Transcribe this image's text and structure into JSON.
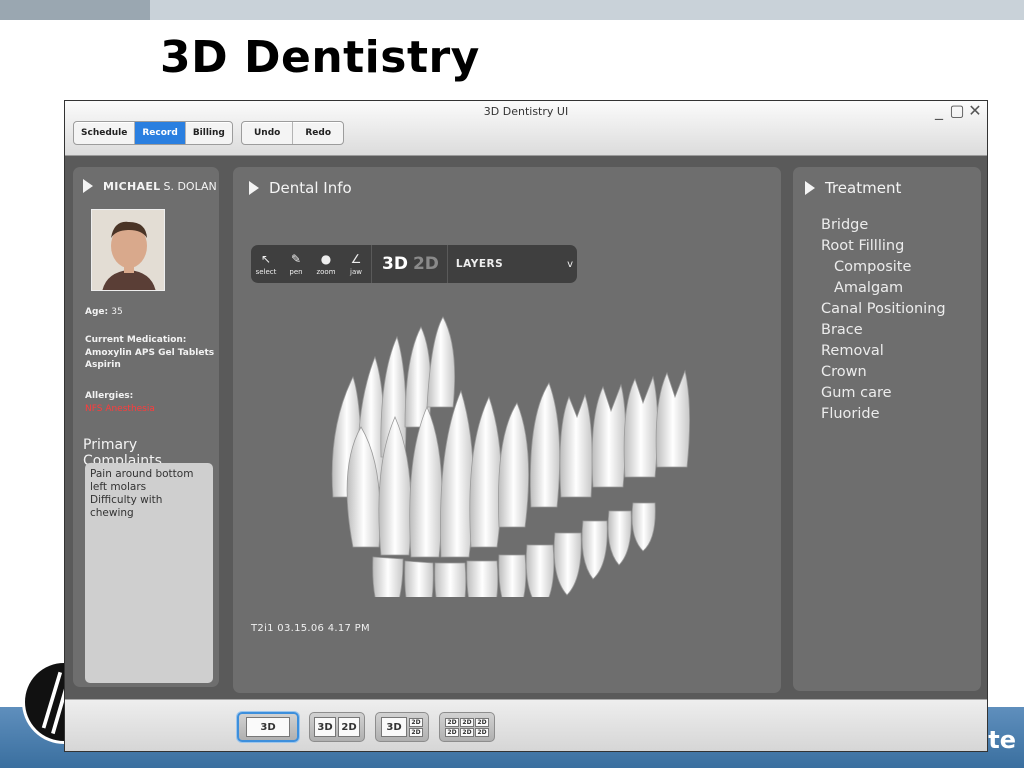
{
  "slide": {
    "title": "3D Dentistry",
    "footer_text": "te"
  },
  "window": {
    "title": "3D Dentistry UI",
    "controls": {
      "minimize": "_",
      "maximize": "▢",
      "close": "✕"
    },
    "nav_tabs": [
      {
        "label": "Schedule",
        "active": false
      },
      {
        "label": "Record",
        "active": true
      },
      {
        "label": "Billing",
        "active": false
      }
    ],
    "history": {
      "undo_label": "Undo",
      "redo_label": "Redo"
    }
  },
  "patient": {
    "first_name": "MICHAEL",
    "rest_name": "S. DOLAN",
    "age_label": "Age:",
    "age_value": "35",
    "medication_label": "Current Medication:",
    "medications": [
      "Amoxylin APS Gel Tablets",
      "Aspirin"
    ],
    "allergies_label": "Allergies:",
    "allergies_value": "NFS Anesthesia",
    "complaints_title": "Primary Complaints",
    "complaints": [
      "Pain around bottom",
      "left molars",
      "Difficulty with chewing"
    ]
  },
  "dental": {
    "title": "Dental Info",
    "tools": [
      {
        "label": "select",
        "icon": "cursor-icon"
      },
      {
        "label": "pen",
        "icon": "pen-icon"
      },
      {
        "label": "zoom",
        "icon": "dot-icon"
      },
      {
        "label": "jaw",
        "icon": "angle-icon"
      }
    ],
    "mode_3d": "3D",
    "mode_2d": "2D",
    "layers_label": "LAYERS",
    "layers_chevron": "v",
    "timestamp": "T2i1  03.15.06  4.17 PM"
  },
  "treatment": {
    "title": "Treatment",
    "items": [
      {
        "label": "Bridge",
        "sub": false
      },
      {
        "label": "Root Fillling",
        "sub": false
      },
      {
        "label": "Composite",
        "sub": true
      },
      {
        "label": "Amalgam",
        "sub": true
      },
      {
        "label": "Canal Positioning",
        "sub": false
      },
      {
        "label": "Brace",
        "sub": false
      },
      {
        "label": "Removal",
        "sub": false
      },
      {
        "label": "Crown",
        "sub": false
      },
      {
        "label": "Gum care",
        "sub": false
      },
      {
        "label": "Fluoride",
        "sub": false
      }
    ]
  },
  "view_modes": {
    "single": "3D",
    "split_left": "3D",
    "split_right": "2D",
    "tri_main": "3D",
    "small_cell": "2D"
  },
  "colors": {
    "accent": "#2a7fe0",
    "allergy": "#ff3b3b",
    "footer": "#3a6f9f"
  }
}
